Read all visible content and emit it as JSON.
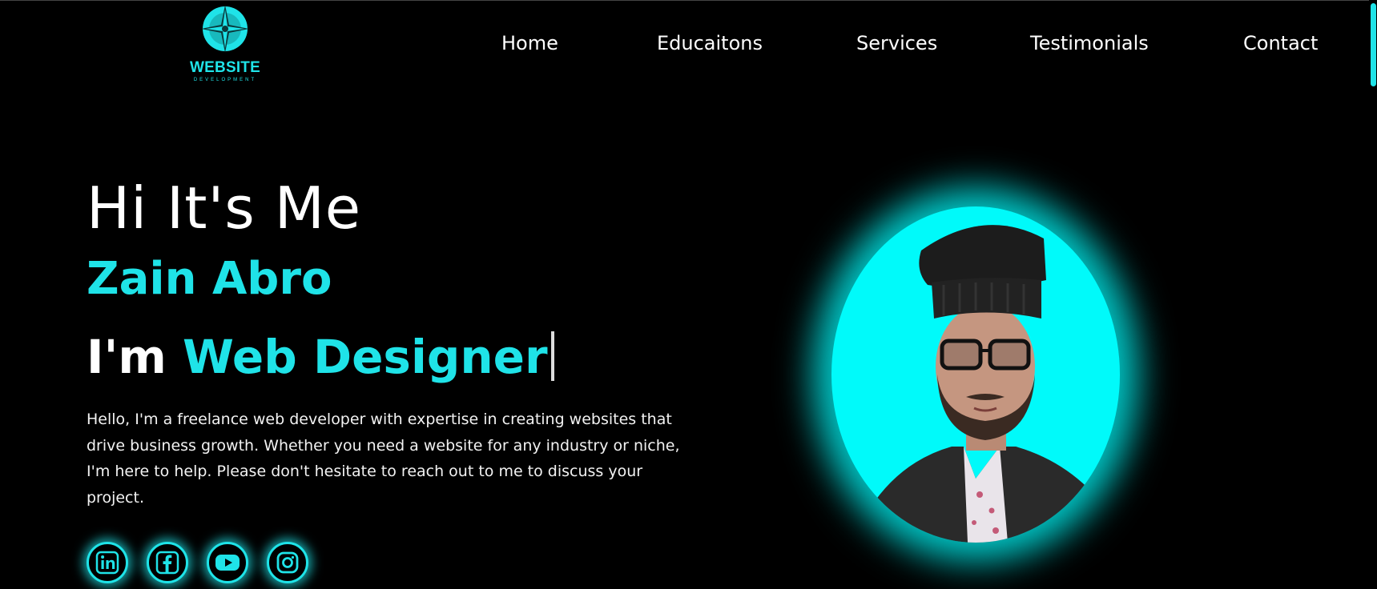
{
  "logo": {
    "title": "WEBSITE",
    "subtitle": "DEVELOPMENT",
    "icon": "compass-star-icon"
  },
  "nav": {
    "items": [
      {
        "label": "Home"
      },
      {
        "label": "Educaitons"
      },
      {
        "label": "Services"
      },
      {
        "label": "Testimonials"
      },
      {
        "label": "Contact"
      }
    ]
  },
  "hero": {
    "greeting": "Hi It's Me",
    "name": "Zain Abro",
    "role_prefix": "I'm",
    "role": "Web Designer",
    "description": "Hello, I'm a freelance web developer with expertise in creating websites that drive business growth. Whether you need a website for any industry or niche, I'm here to help. Please don't hesitate to reach out to me to discuss your project."
  },
  "socials": [
    {
      "icon": "linkedin-icon"
    },
    {
      "icon": "facebook-icon"
    },
    {
      "icon": "youtube-icon"
    },
    {
      "icon": "instagram-icon"
    }
  ],
  "colors": {
    "accent": "#1fe3e8",
    "background": "#000000",
    "glow": "#00fafa"
  }
}
